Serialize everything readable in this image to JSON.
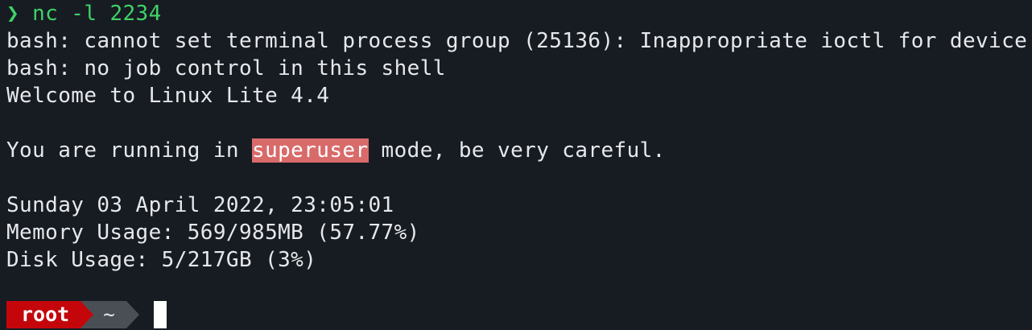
{
  "terminal": {
    "prompt_symbol": "❯",
    "command": "nc -l 2234",
    "output": {
      "line1": "bash: cannot set terminal process group (25136): Inappropriate ioctl for device",
      "line2": "bash: no job control in this shell",
      "line3": "Welcome to Linux Lite 4.4",
      "line4_prefix": "You are running in ",
      "line4_highlight": "superuser",
      "line4_suffix": " mode, be very careful.",
      "line5": "Sunday 03 April 2022, 23:05:01",
      "line6": "Memory Usage: 569/985MB (57.77%)",
      "line7": "Disk Usage: 5/217GB (3%)"
    },
    "prompt": {
      "user": "root",
      "directory": "~"
    }
  },
  "colors": {
    "background": "#171c23",
    "text": "#e6e8eb",
    "prompt_green": "#3fd267",
    "highlight_bg": "#d96a6a",
    "root_segment": "#c4060b",
    "dir_segment": "#4a4f55"
  }
}
